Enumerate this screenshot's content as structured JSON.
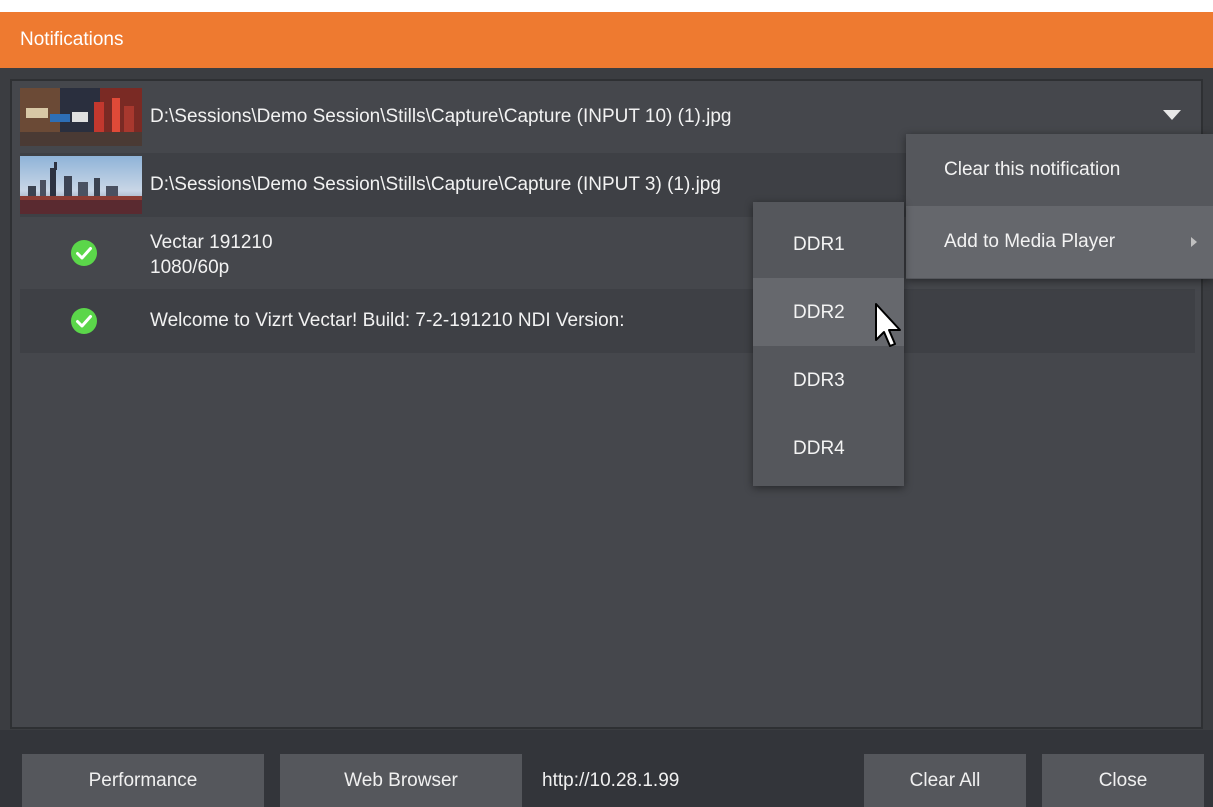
{
  "window": {
    "title": "Notifications"
  },
  "notifications": [
    {
      "type": "image",
      "text": "D:\\Sessions\\Demo Session\\Stills\\Capture\\Capture (INPUT 10) (1).jpg",
      "thumbnail": "street-scene-thumbnail"
    },
    {
      "type": "image",
      "text": "D:\\Sessions\\Demo Session\\Stills\\Capture\\Capture (INPUT 3) (1).jpg",
      "thumbnail": "city-skyline-thumbnail"
    },
    {
      "type": "status",
      "line1": "Vectar 191210",
      "line2": "1080/60p",
      "icon": "check-circle-icon"
    },
    {
      "type": "status",
      "text": "Welcome to Vizrt Vectar! Build: 7-2-191210 NDI Version:",
      "icon": "check-circle-icon"
    }
  ],
  "context_menu": {
    "items": [
      {
        "label": "Clear this notification"
      },
      {
        "label": "Add to Media Player",
        "has_submenu": true
      }
    ]
  },
  "submenu": {
    "items": [
      {
        "label": "DDR1"
      },
      {
        "label": "DDR2"
      },
      {
        "label": "DDR3"
      },
      {
        "label": "DDR4"
      }
    ],
    "hovered": "DDR2"
  },
  "footer": {
    "performance_label": "Performance",
    "web_browser_label": "Web Browser",
    "url": "http://10.28.1.99",
    "clear_all_label": "Clear All",
    "close_label": "Close"
  },
  "colors": {
    "accent": "#ee7a30",
    "background": "#3b3d41",
    "panel": "#45474c",
    "menu": "#55575c",
    "check": "#5bd64a"
  }
}
